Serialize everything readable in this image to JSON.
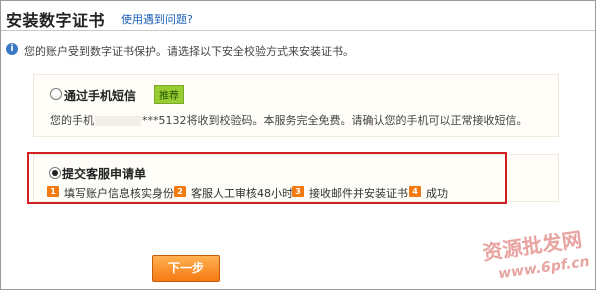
{
  "header": {
    "title": "安装数字证书",
    "help_link": "使用遇到问题?"
  },
  "info": {
    "icon": "info-icon",
    "text": "您的账户受到数字证书保护。请选择以下安全校验方式来安装证书。"
  },
  "options": {
    "sms": {
      "label": "通过手机短信",
      "badge": "推荐",
      "selected": false,
      "desc_prefix": "您的手机",
      "desc_suffix": "***5132将收到校验码。本服务完全免费。请确认您的手机可以正常接收短信。"
    },
    "service": {
      "label": "提交客服申请单",
      "selected": true,
      "steps": [
        {
          "num": "1",
          "text": "填写账户信息核实身份"
        },
        {
          "num": "2",
          "text": "客服人工审核48小时"
        },
        {
          "num": "3",
          "text": "接收邮件并安装证书"
        },
        {
          "num": "4",
          "text": "成功"
        }
      ]
    }
  },
  "next_button": "下一步",
  "watermark": {
    "text": "资源批发网",
    "url": "www.6pf.cn"
  },
  "colors": {
    "highlight_border": "#d02020",
    "button_orange": "#f57a12",
    "badge_green": "#9acd32",
    "link_blue": "#1a5fb4"
  }
}
